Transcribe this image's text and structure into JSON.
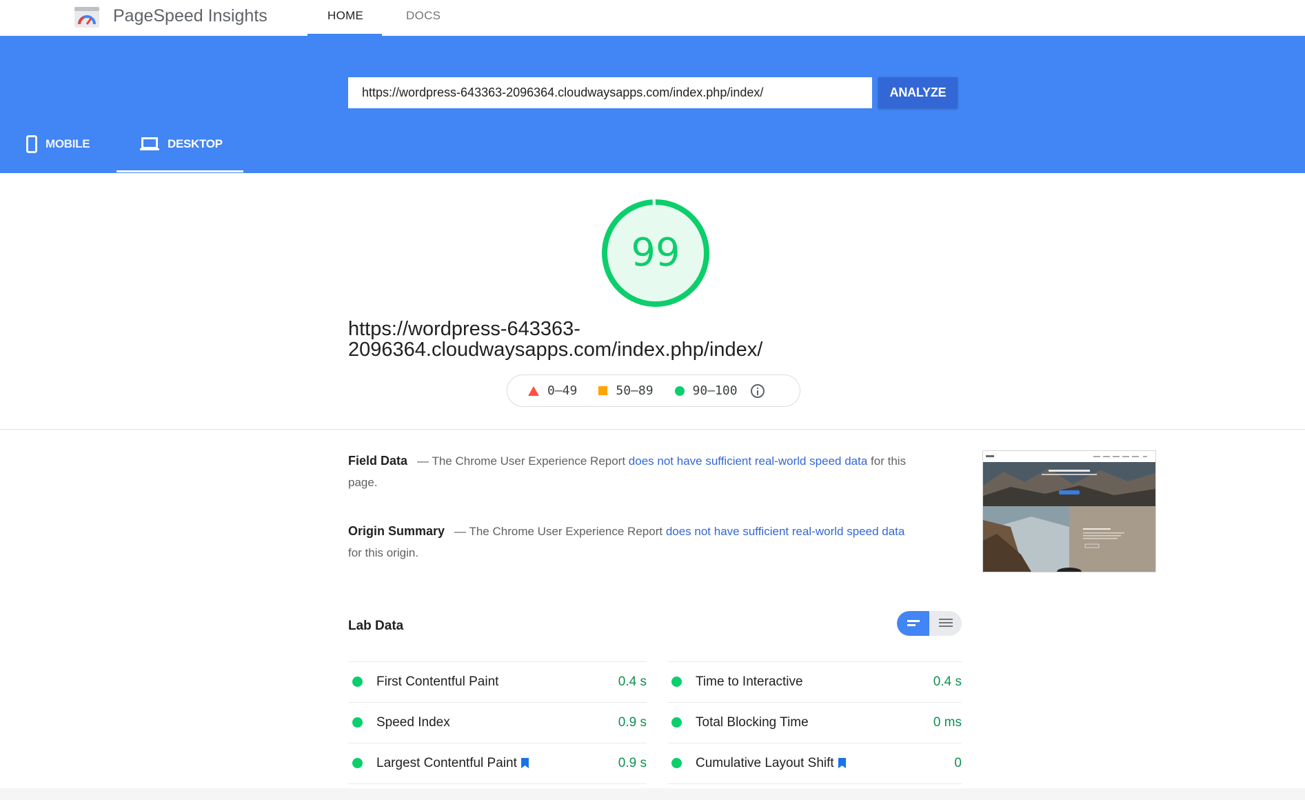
{
  "nav": {
    "brand": "PageSpeed Insights",
    "tabs": [
      "HOME",
      "DOCS"
    ]
  },
  "search": {
    "url_value": "https://wordpress-643363-2096364.cloudwaysapps.com/index.php/index/",
    "button": "ANALYZE"
  },
  "device_tabs": [
    "MOBILE",
    "DESKTOP"
  ],
  "score": {
    "value": "99",
    "percent": 99,
    "color": "#0cce6b"
  },
  "tested_url_line1": "https://wordpress-643363-",
  "tested_url_line2": "2096364.cloudwaysapps.com/index.php/index/",
  "legend": [
    "0–49",
    "50–89",
    "90–100"
  ],
  "field_data": {
    "title": "Field Data",
    "pre": "— The Chrome User Experience Report ",
    "link": "does not have sufficient real-world speed data",
    "post": " for this page."
  },
  "origin_summary": {
    "title": "Origin Summary",
    "pre": "— The Chrome User Experience Report ",
    "link": "does not have sufficient real-world speed data",
    "post": " for this origin."
  },
  "lab": {
    "title": "Lab Data",
    "left": [
      {
        "label": "First Contentful Paint",
        "value": "0.4 s"
      },
      {
        "label": "Speed Index",
        "value": "0.9 s"
      },
      {
        "label": "Largest Contentful Paint",
        "value": "0.9 s"
      }
    ],
    "right": [
      {
        "label": "Time to Interactive",
        "value": "0.4 s"
      },
      {
        "label": "Total Blocking Time",
        "value": "0 ms"
      },
      {
        "label": "Cumulative Layout Shift",
        "value": "0"
      }
    ]
  },
  "colors": {
    "brand_blue": "#4285f4",
    "pass_green": "#0cce6b",
    "link_blue": "#3367d6",
    "fail_red": "#ff4e42",
    "avg_orange": "#ffa400"
  }
}
